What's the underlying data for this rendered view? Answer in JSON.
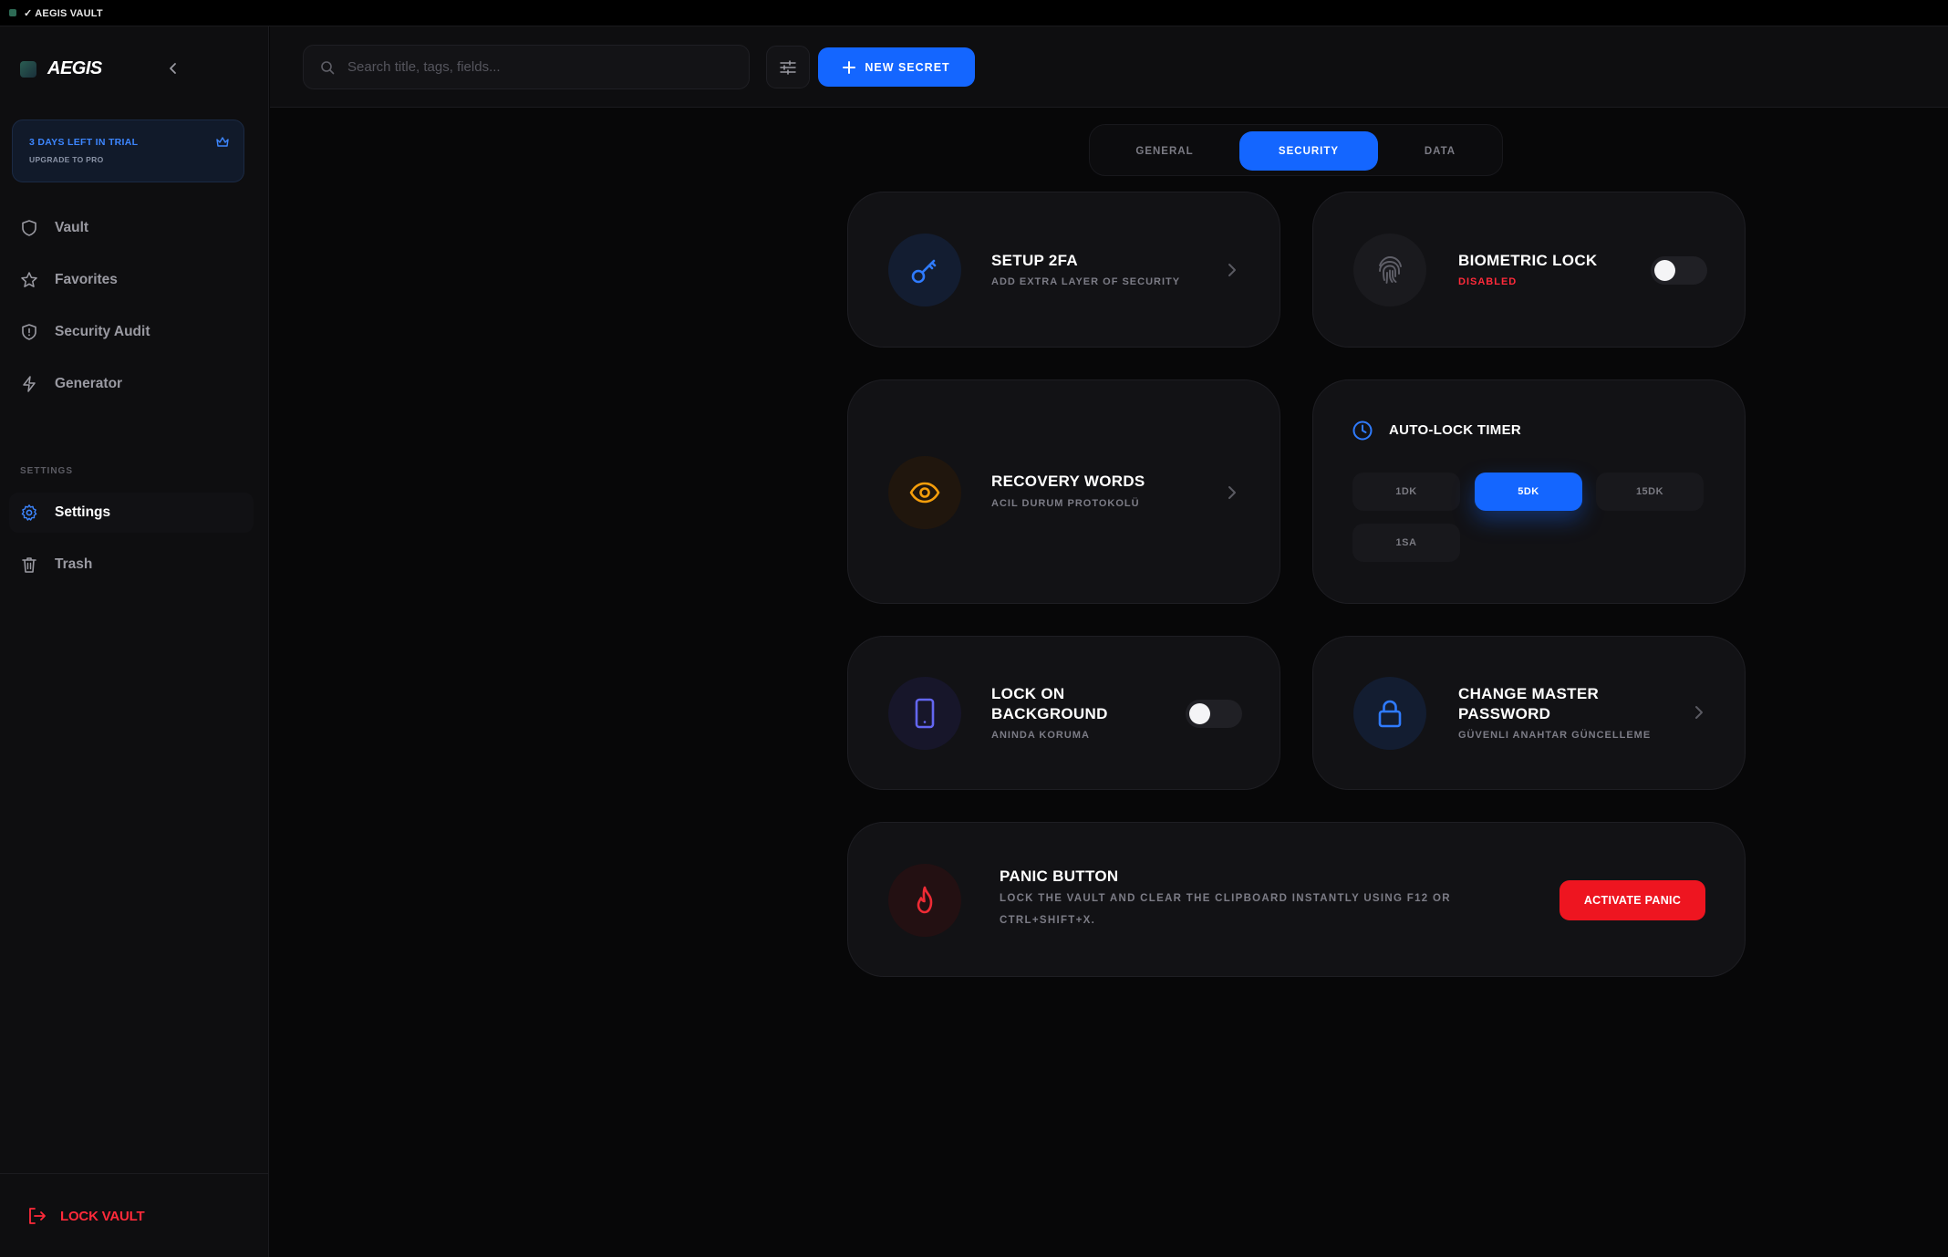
{
  "window": {
    "title": "✓ AEGIS VAULT"
  },
  "sidebar": {
    "brand": "AEGIS",
    "trial": {
      "title": "3 DAYS LEFT IN TRIAL",
      "subtitle": "UPGRADE TO PRO"
    },
    "nav": [
      {
        "label": "Vault",
        "icon": "shield-icon"
      },
      {
        "label": "Favorites",
        "icon": "star-icon"
      },
      {
        "label": "Security Audit",
        "icon": "shield-alert-icon"
      },
      {
        "label": "Generator",
        "icon": "lightning-icon"
      }
    ],
    "section_label": "SETTINGS",
    "settings_nav": [
      {
        "label": "Settings",
        "icon": "gear-icon",
        "active": true
      },
      {
        "label": "Trash",
        "icon": "trash-icon"
      }
    ],
    "lock_label": "LOCK VAULT"
  },
  "topbar": {
    "search_placeholder": "Search title, tags, fields...",
    "new_secret_label": "NEW SECRET"
  },
  "tabs": [
    {
      "label": "GENERAL",
      "active": false
    },
    {
      "label": "SECURITY",
      "active": true
    },
    {
      "label": "DATA",
      "active": false
    }
  ],
  "cards": {
    "setup_2fa": {
      "title": "SETUP 2FA",
      "subtitle": "ADD EXTRA LAYER OF SECURITY"
    },
    "biometric": {
      "title": "BIOMETRIC LOCK",
      "status": "DISABLED",
      "enabled": false
    },
    "recovery": {
      "title": "RECOVERY WORDS",
      "subtitle": "ACIL DURUM PROTOKOLÜ"
    },
    "autolock": {
      "title": "AUTO-LOCK TIMER",
      "options": [
        "1DK",
        "5DK",
        "15DK",
        "1SA"
      ],
      "selected": "5DK"
    },
    "lock_background": {
      "title_line1": "LOCK ON",
      "title_line2": "BACKGROUND",
      "subtitle": "ANINDA KORUMA",
      "enabled": false
    },
    "change_master": {
      "title_line1": "CHANGE MASTER",
      "title_line2": "PASSWORD",
      "subtitle": "GÜVENLI ANAHTAR GÜNCELLEME"
    },
    "panic": {
      "title": "PANIC BUTTON",
      "desc_line1": "LOCK THE VAULT AND CLEAR THE CLIPBOARD INSTANTLY USING F12 OR",
      "desc_line2": "CTRL+SHIFT+X.",
      "button": "ACTIVATE PANIC"
    }
  },
  "colors": {
    "accent": "#1466ff",
    "danger": "#ee1520",
    "recovery_icon": "#f59e0b",
    "device_icon": "#6366f1"
  }
}
